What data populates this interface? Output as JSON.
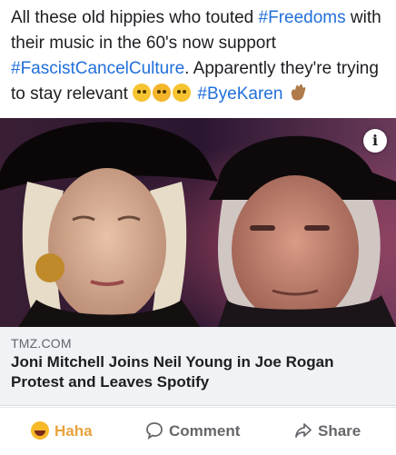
{
  "post": {
    "line1": "All these old hippies who touted ",
    "tag_freedoms": "#Freedoms",
    "line2": " with their music in the 60's now support ",
    "tag_fascist": "#FascistCancelCulture",
    "line3": ". Apparently they're trying to stay relevant ",
    "tag_byekaren": "#ByeKaren"
  },
  "link": {
    "domain": "TMZ.COM",
    "title": "Joni Mitchell Joins Neil Young in Joe Rogan Protest and Leaves Spotify"
  },
  "actions": {
    "haha": "Haha",
    "comment": "Comment",
    "share": "Share"
  },
  "colors": {
    "hashtag": "#216fdb",
    "haha_active": "#e8a33d",
    "link_bg": "#f0f2f5"
  },
  "icons": [
    "info-icon",
    "haha-icon",
    "comment-icon",
    "share-icon",
    "eyeroll-emoji",
    "thinking-emoji",
    "wave-hand-emoji"
  ]
}
